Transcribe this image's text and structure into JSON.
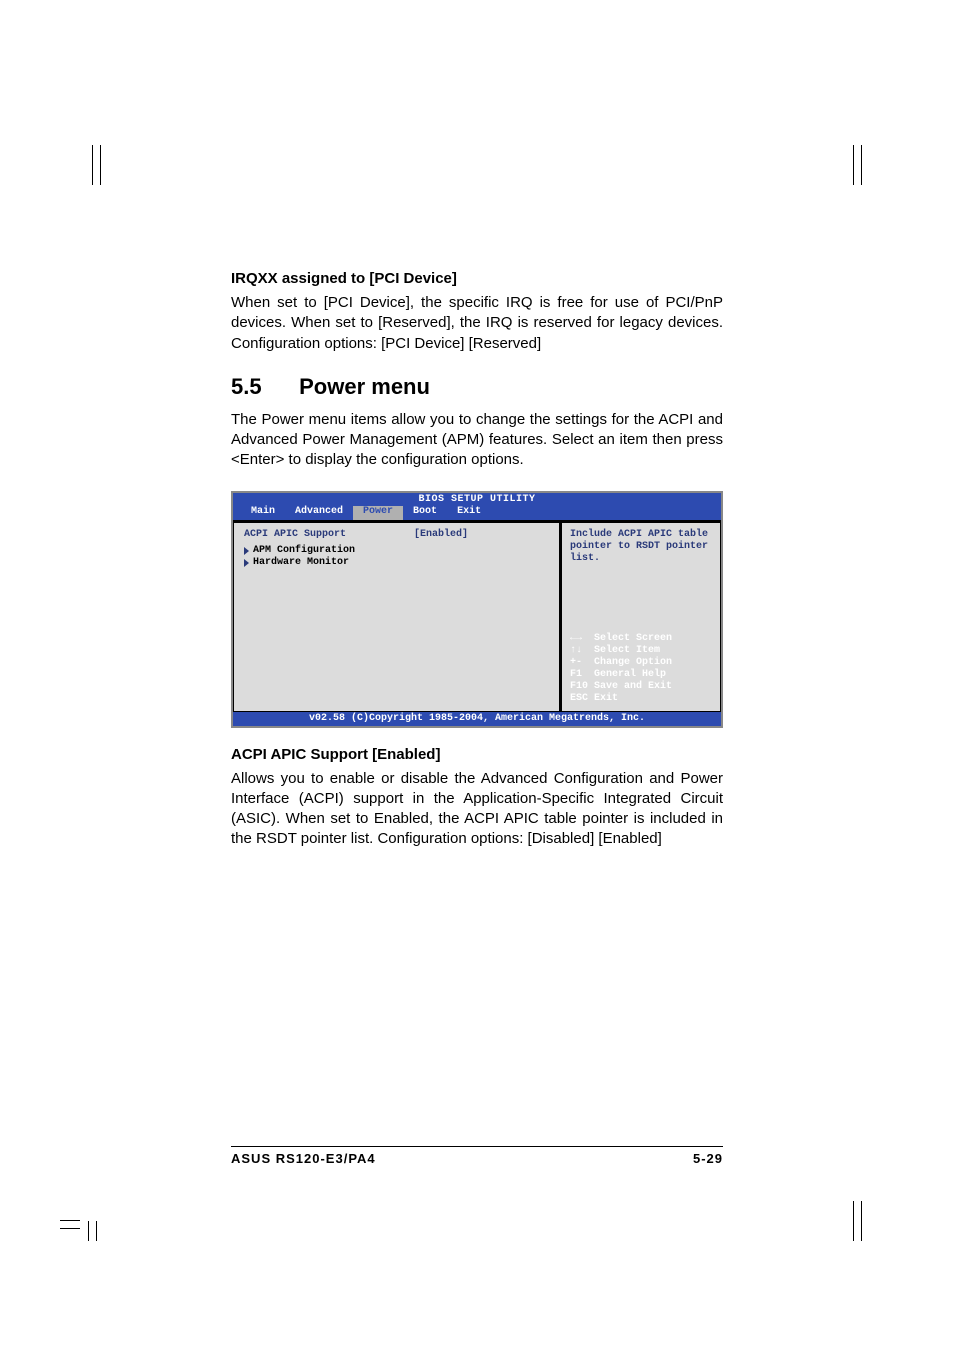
{
  "section1": {
    "title": "IRQXX assigned to [PCI Device]",
    "body": "When set to [PCI Device], the specific IRQ is free for use of PCI/PnP devices. When set to [Reserved], the IRQ is reserved for legacy devices. Configuration options: [PCI Device] [Reserved]"
  },
  "heading": {
    "num": "5.5",
    "title": "Power menu"
  },
  "power_intro": "The Power menu items allow you to change the settings for the ACPI and Advanced Power Management (APM) features. Select an item then press <Enter> to display the configuration options.",
  "bios": {
    "header": "BIOS SETUP UTILITY",
    "tabs": [
      "Main",
      "Advanced",
      "Power",
      "Boot",
      "Exit"
    ],
    "selected_tab": 2,
    "item": {
      "label": "ACPI APIC Support",
      "value": "[Enabled]"
    },
    "subs": [
      "APM Configuration",
      "Hardware Monitor"
    ],
    "help": "Include ACPI APIC table pointer to RSDT pointer list.",
    "keys": [
      {
        "sym": "↔",
        "desc": "Select Screen"
      },
      {
        "sym": "↕",
        "desc": "Select Item"
      },
      {
        "sym": "+-",
        "desc": "Change Option"
      },
      {
        "sym": "F1",
        "desc": "General Help"
      },
      {
        "sym": "F10",
        "desc": "Save and Exit"
      },
      {
        "sym": "ESC",
        "desc": "Exit"
      }
    ],
    "footer": "v02.58 (C)Copyright 1985-2004, American Megatrends, Inc."
  },
  "section2": {
    "title": "ACPI APIC Support [Enabled]",
    "body": "Allows you to enable or disable the Advanced Configuration and Power Interface (ACPI) support in the Application-Specific Integrated Circuit (ASIC). When set to Enabled, the ACPI APIC table pointer is included in the RSDT pointer list. Configuration options: [Disabled] [Enabled]"
  },
  "footer": {
    "left": "ASUS RS120-E3/PA4",
    "right": "5-29"
  }
}
